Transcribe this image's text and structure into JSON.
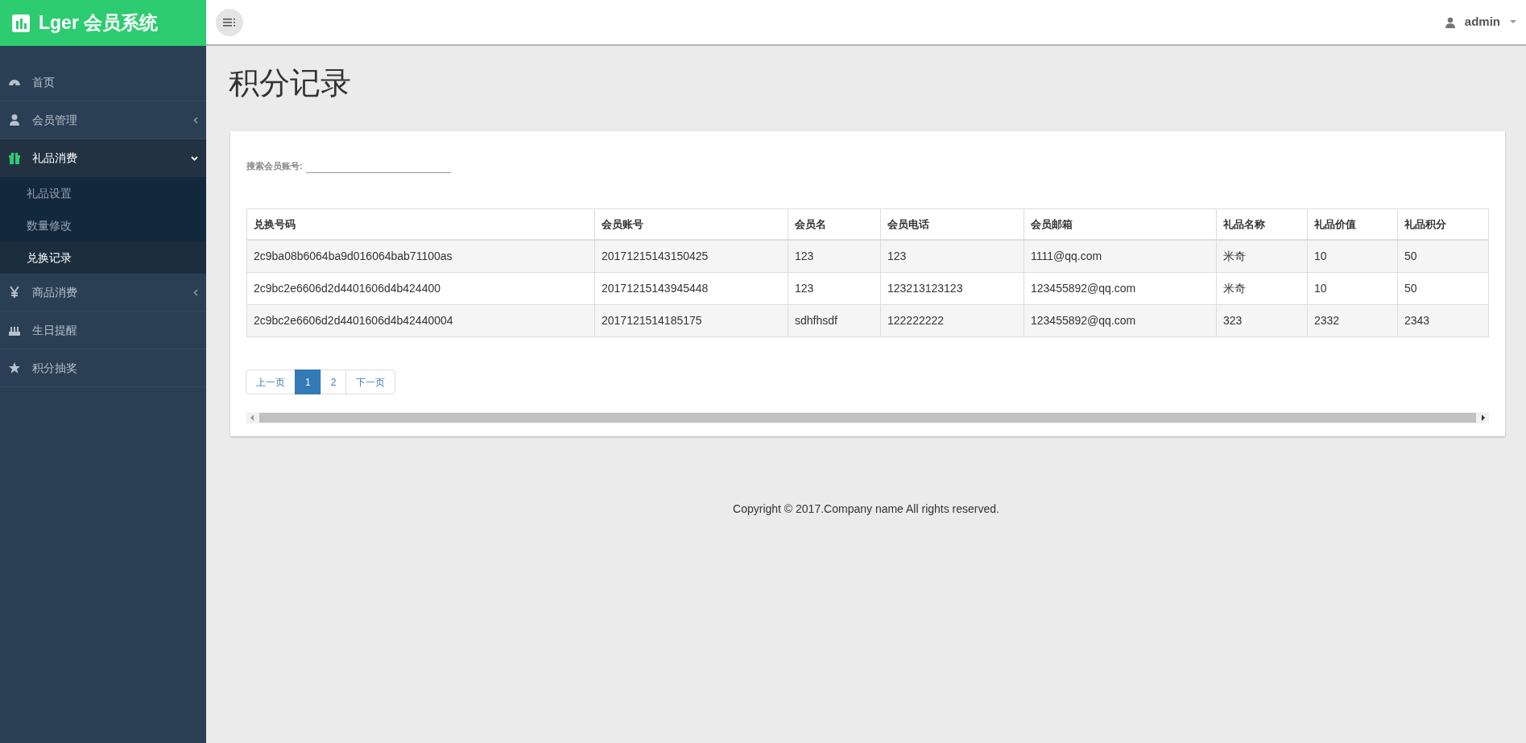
{
  "brand": {
    "title": "Lger 会员系统"
  },
  "header": {
    "user": "admin"
  },
  "sidebar": {
    "items": [
      {
        "label": "首页",
        "selected": false
      },
      {
        "label": "会员管理",
        "selected": false,
        "expanded": false
      },
      {
        "label": "礼品消费",
        "selected": true,
        "expanded": true,
        "children": [
          {
            "label": "礼品设置",
            "selected": false
          },
          {
            "label": "数量修改",
            "selected": false
          },
          {
            "label": "兑换记录",
            "selected": true
          }
        ]
      },
      {
        "label": "商品消费",
        "selected": false,
        "expanded": false
      },
      {
        "label": "生日提醒",
        "selected": false
      },
      {
        "label": "积分抽奖",
        "selected": false
      }
    ]
  },
  "page": {
    "title": "积分记录"
  },
  "search": {
    "label": "搜索会员账号:"
  },
  "table": {
    "columns": [
      "兑换号码",
      "会员账号",
      "会员名",
      "会员电话",
      "会员邮箱",
      "礼品名称",
      "礼品价值",
      "礼品积分"
    ],
    "rows": [
      [
        "2c9ba08b6064ba9d016064bab71100as",
        "20171215143150425",
        "123",
        "123",
        "1111@qq.com",
        "米奇",
        "10",
        "50"
      ],
      [
        "2c9bc2e6606d2d4401606d4b424400",
        "20171215143945448",
        "123",
        "123213123123",
        "123455892@qq.com",
        "米奇",
        "10",
        "50"
      ],
      [
        "2c9bc2e6606d2d4401606d4b42440004",
        "2017121514185175",
        "sdhfhsdf",
        "122222222",
        "123455892@qq.com",
        "323",
        "2332",
        "2343"
      ]
    ]
  },
  "pagination": {
    "prev": "上一页",
    "pages": [
      {
        "label": "1",
        "selected": true
      },
      {
        "label": "2",
        "selected": false
      }
    ],
    "next": "下一页"
  },
  "footer": {
    "text": "Copyright © 2017.Company name All rights reserved."
  }
}
